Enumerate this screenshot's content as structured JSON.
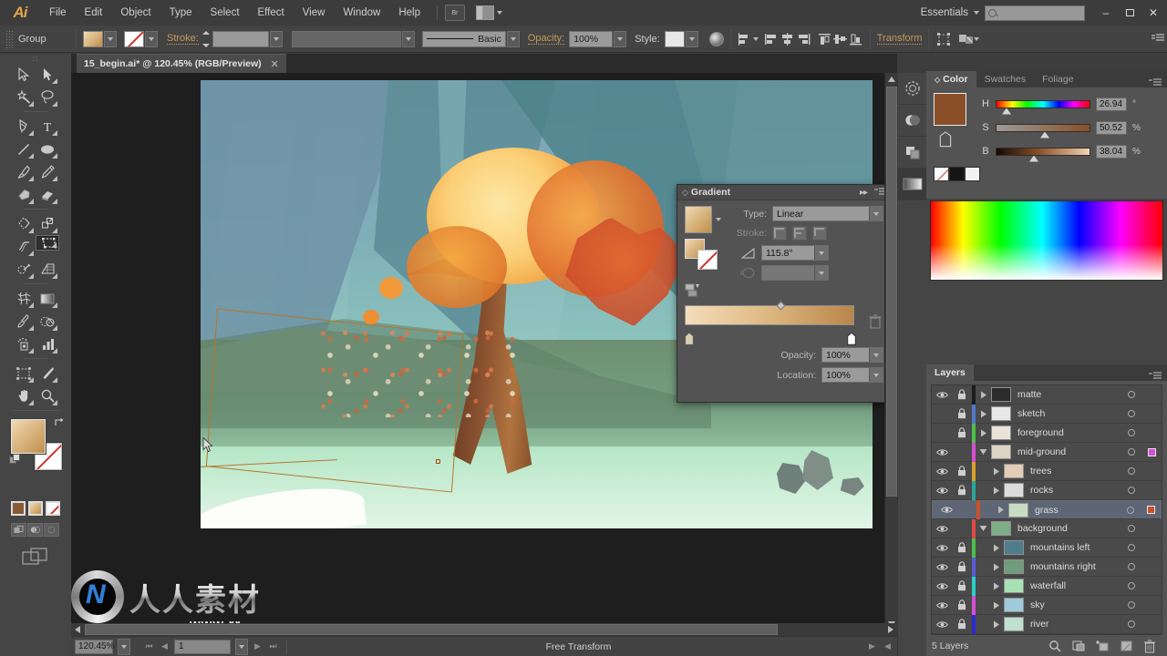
{
  "app": {
    "name": "Adobe Illustrator",
    "logo_text": "Ai",
    "workspace": "Essentials",
    "search_placeholder": ""
  },
  "menubar": {
    "items": [
      "File",
      "Edit",
      "Object",
      "Type",
      "Select",
      "Effect",
      "View",
      "Window",
      "Help"
    ],
    "bridge_label": "Br",
    "minimize": "–",
    "maximize": "❐",
    "close": "✕"
  },
  "controlbar": {
    "selection_label": "Group",
    "stroke_label": "Stroke:",
    "stroke_weight": "",
    "stroke_profile": "",
    "brush_label": "Basic",
    "opacity_label": "Opacity:",
    "opacity_value": "100%",
    "style_label": "Style:",
    "transform_label": "Transform"
  },
  "toolbar": {
    "tools": [
      "selection-tool",
      "direct-selection-tool",
      "magic-wand-tool",
      "lasso-tool",
      "pen-tool",
      "type-tool",
      "line-segment-tool",
      "ellipse-tool",
      "paintbrush-tool",
      "pencil-tool",
      "blob-brush-tool",
      "eraser-tool",
      "rotate-tool",
      "scale-tool",
      "width-tool",
      "free-transform-tool",
      "shape-builder-tool",
      "perspective-grid-tool",
      "mesh-tool",
      "gradient-tool",
      "eyedropper-tool",
      "blend-tool",
      "symbol-sprayer-tool",
      "column-graph-tool",
      "artboard-tool",
      "slice-tool",
      "hand-tool",
      "zoom-tool"
    ],
    "selected_tool": "free-transform-tool",
    "fill_label": "Fill",
    "stroke_label": "Stroke"
  },
  "document": {
    "tab_title": "15_begin.ai* @ 120.45% (RGB/Preview)",
    "close_glyph": "✕"
  },
  "statusbar": {
    "zoom": "120.45%",
    "page": "1",
    "status_text": "Free Transform"
  },
  "gradient_panel": {
    "title": "Gradient",
    "type_label": "Type:",
    "type_value": "Linear",
    "stroke_label": "Stroke:",
    "angle_value": "115.8°",
    "aspect_value": "",
    "opacity_label": "Opacity:",
    "opacity_value": "100%",
    "location_label": "Location:",
    "location_value": "100%"
  },
  "color_panel": {
    "tabs": [
      "Color",
      "Swatches",
      "Foliage"
    ],
    "active_tab": "Color",
    "mode": "HSB",
    "sliders": [
      {
        "label": "H",
        "value": "26.94",
        "unit": "°",
        "pos": 8
      },
      {
        "label": "S",
        "value": "50.52",
        "unit": "%",
        "pos": 50
      },
      {
        "label": "B",
        "value": "38.04",
        "unit": "%",
        "pos": 38
      }
    ],
    "fill_color": "#8a4f28",
    "swatch_none": "None",
    "swatch_black": "#1a1a1a",
    "swatch_white": "#f2f2f2"
  },
  "layers_panel": {
    "title": "Layers",
    "footer_count": "5 Layers",
    "rows": [
      {
        "name": "matte",
        "visible": true,
        "locked": true,
        "color": "#1c1c1c",
        "indent": 0,
        "expanded": false,
        "selected": false,
        "targeted": false,
        "thumb": "#2b2b2b"
      },
      {
        "name": "sketch",
        "visible": false,
        "locked": true,
        "color": "#4f79c9",
        "indent": 0,
        "expanded": false,
        "selected": false,
        "targeted": false,
        "thumb": "#e8e8e8"
      },
      {
        "name": "foreground",
        "visible": false,
        "locked": true,
        "color": "#4bbf4b",
        "indent": 0,
        "expanded": false,
        "selected": false,
        "targeted": false,
        "thumb": "#e9e2d8"
      },
      {
        "name": "mid-ground",
        "visible": true,
        "locked": false,
        "color": "#d44fd4",
        "indent": 0,
        "expanded": true,
        "selected": false,
        "targeted": true,
        "thumb": "#ddd3c4"
      },
      {
        "name": "trees",
        "visible": true,
        "locked": true,
        "color": "#d8a12a",
        "indent": 1,
        "expanded": false,
        "selected": false,
        "targeted": false,
        "thumb": "#e3cdb6"
      },
      {
        "name": "rocks",
        "visible": true,
        "locked": true,
        "color": "#2aa79a",
        "indent": 1,
        "expanded": false,
        "selected": false,
        "targeted": false,
        "thumb": "#dcdcdc"
      },
      {
        "name": "grass",
        "visible": true,
        "locked": false,
        "color": "#c7522a",
        "indent": 1,
        "expanded": false,
        "selected": true,
        "targeted": true,
        "thumb": "#c8dcc4"
      },
      {
        "name": "background",
        "visible": true,
        "locked": false,
        "color": "#e04a4a",
        "indent": 0,
        "expanded": true,
        "selected": false,
        "targeted": false,
        "thumb": "#7fae86"
      },
      {
        "name": "mountains left",
        "visible": true,
        "locked": true,
        "color": "#4bbf4b",
        "indent": 1,
        "expanded": false,
        "selected": false,
        "targeted": false,
        "thumb": "#4f7d8c"
      },
      {
        "name": "mountains right",
        "visible": true,
        "locked": true,
        "color": "#5a5ad8",
        "indent": 1,
        "expanded": false,
        "selected": false,
        "targeted": false,
        "thumb": "#6f9c7d"
      },
      {
        "name": "waterfall",
        "visible": true,
        "locked": true,
        "color": "#2ad0c8",
        "indent": 1,
        "expanded": false,
        "selected": false,
        "targeted": false,
        "thumb": "#a8e2b4"
      },
      {
        "name": "sky",
        "visible": true,
        "locked": true,
        "color": "#d44fd4",
        "indent": 1,
        "expanded": false,
        "selected": false,
        "targeted": false,
        "thumb": "#9ecadb"
      },
      {
        "name": "river",
        "visible": true,
        "locked": true,
        "color": "#2a2ad0",
        "indent": 1,
        "expanded": false,
        "selected": false,
        "targeted": false,
        "thumb": "#bfe0cf"
      }
    ]
  },
  "dock_icons": [
    "brushes-icon",
    "transparency-icon",
    "pathfinder-icon",
    "gradient-icon"
  ],
  "watermark": {
    "chinese": "人人素材",
    "url": "www.rr-sc.com",
    "mark": "N"
  },
  "artwork": {
    "description": "autumn tree on green hill with teal mountains and waterfall",
    "selection_hint": "free-transform-bounding-box"
  }
}
